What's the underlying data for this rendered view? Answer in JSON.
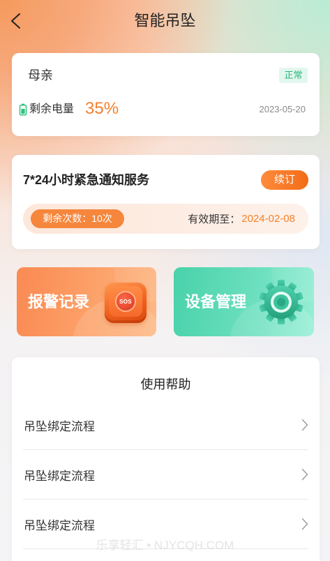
{
  "header": {
    "title": "智能吊坠"
  },
  "device_card": {
    "name": "母亲",
    "status": "正常",
    "battery_label": "剩余电量",
    "battery_value": "35%",
    "date": "2023-05-20"
  },
  "service_card": {
    "title": "7*24小时紧急通知服务",
    "renew_label": "续订",
    "remaining": "剩余次数：10次",
    "valid_label": "有效期至：",
    "valid_date": "2024-02-08"
  },
  "tiles": [
    {
      "label": "报警记录",
      "icon": "sos-button-icon",
      "icon_text": "SOS"
    },
    {
      "label": "设备管理",
      "icon": "gear-icon"
    }
  ],
  "help": {
    "title": "使用帮助",
    "items": [
      {
        "label": "吊坠绑定流程"
      },
      {
        "label": "吊坠绑定流程"
      },
      {
        "label": "吊坠绑定流程"
      }
    ]
  },
  "watermark": "乐享轻汇 • NJYCQH.COM",
  "icons": {
    "back": "chevron-left-icon",
    "battery": "battery-icon",
    "row_arrow": "chevron-right-icon"
  },
  "colors": {
    "accent_orange": "#f57f2e",
    "status_green": "#2bb67c",
    "alarm_tile": "#fa8a52",
    "device_tile": "#48d2aa"
  }
}
